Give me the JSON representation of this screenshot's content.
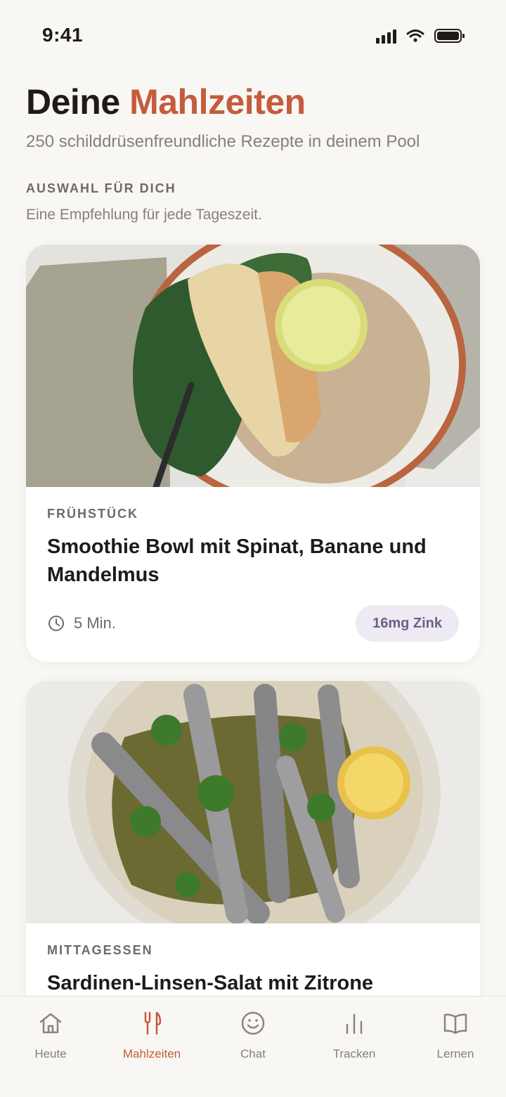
{
  "status_bar": {
    "time": "9:41"
  },
  "header": {
    "title_plain": "Deine",
    "title_accent": "Mahlzeiten",
    "subtitle": "250 schilddrüsenfreundliche Rezepte in deinem Pool"
  },
  "section": {
    "label": "AUSWAHL FÜR DICH",
    "description": "Eine Empfehlung für jede Tageszeit."
  },
  "recipes": [
    {
      "meal": "FRÜHSTÜCK",
      "title": "Smoothie Bowl mit Spinat, Banane und Mandelmus",
      "time": "5 Min.",
      "nutrient": "16mg Zink",
      "image": "smoothie-bowl-photo"
    },
    {
      "meal": "MITTAGESSEN",
      "title": "Sardinen-Linsen-Salat mit Zitrone",
      "image": "sardine-lentil-salad-photo"
    }
  ],
  "nav": {
    "active": "Mahlzeiten",
    "items": [
      {
        "label": "Heute",
        "icon": "home-icon"
      },
      {
        "label": "Mahlzeiten",
        "icon": "fork-knife-icon"
      },
      {
        "label": "Chat",
        "icon": "smiley-icon"
      },
      {
        "label": "Tracken",
        "icon": "bar-chart-icon"
      },
      {
        "label": "Lernen",
        "icon": "book-icon"
      }
    ]
  },
  "colors": {
    "accent": "#c45c3c",
    "background": "#f8f7f4",
    "badge_bg": "#edeaf3",
    "badge_text": "#6c6088"
  }
}
